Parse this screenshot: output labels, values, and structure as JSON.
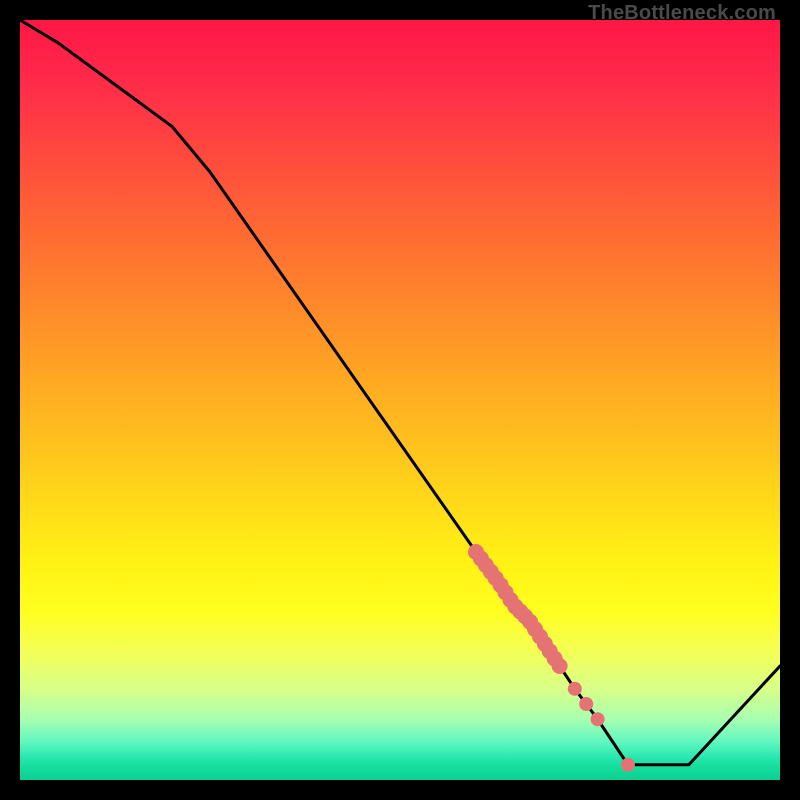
{
  "watermark": "TheBottleneck.com",
  "colors": {
    "line": "#000000",
    "marker": "#e57373",
    "background_top": "#ff1744",
    "background_bottom": "#0ad090",
    "frame_border": "#000000"
  },
  "chart_data": {
    "type": "line",
    "title": "",
    "xlabel": "",
    "ylabel": "",
    "xlim": [
      0,
      100
    ],
    "ylim": [
      0,
      100
    ],
    "x": [
      0,
      5,
      20,
      25,
      60,
      63,
      65,
      67,
      69,
      71,
      73,
      74.5,
      76,
      78,
      80,
      88,
      100
    ],
    "values": [
      100,
      97,
      86,
      80,
      30,
      26,
      23,
      21,
      18,
      15,
      12,
      10,
      8,
      5,
      2,
      2,
      15
    ],
    "markers": {
      "segment": {
        "x_start": 60,
        "x_end": 71,
        "count": 18
      },
      "extra_points": [
        {
          "x": 73,
          "y": 12
        },
        {
          "x": 74.5,
          "y": 10
        },
        {
          "x": 76,
          "y": 8
        },
        {
          "x": 80,
          "y": 2
        }
      ]
    }
  }
}
